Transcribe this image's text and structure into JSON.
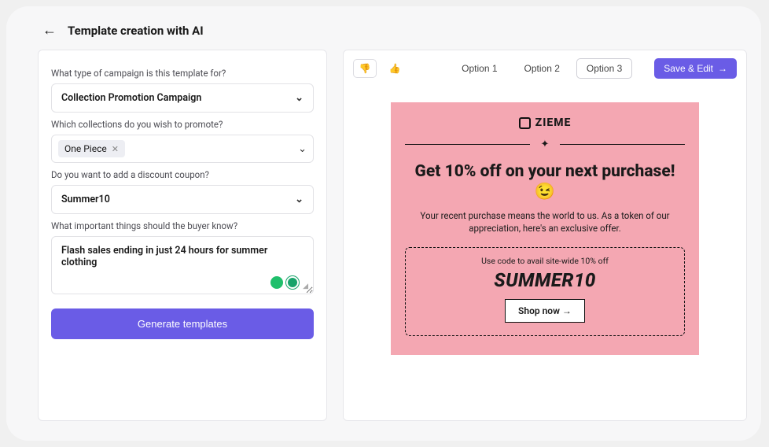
{
  "header": {
    "title": "Template creation with AI"
  },
  "form": {
    "campaign_type": {
      "label": "What type of campaign is this template for?",
      "value": "Collection Promotion Campaign"
    },
    "collections": {
      "label": "Which collections do you wish to promote?",
      "tag": "One Piece"
    },
    "coupon": {
      "label": "Do you want to add a discount coupon?",
      "value": "Summer10"
    },
    "notes": {
      "label": "What important things should the buyer know?",
      "value": "Flash sales ending in just 24 hours for summer clothing"
    },
    "generate_label": "Generate templates"
  },
  "toolbar": {
    "options": [
      "Option 1",
      "Option 2",
      "Option 3"
    ],
    "active_option_index": 2,
    "save_label": "Save & Edit"
  },
  "email": {
    "brand": "ZIEME",
    "headline": "Get 10% off on your next purchase!",
    "emoji": "😉",
    "subtext": "Your recent purchase means the world to us. As a token of our appreciation, here's an exclusive offer.",
    "coupon_label": "Use code to avail site-wide 10% off",
    "coupon_code": "SUMMER10",
    "cta": "Shop now →"
  }
}
